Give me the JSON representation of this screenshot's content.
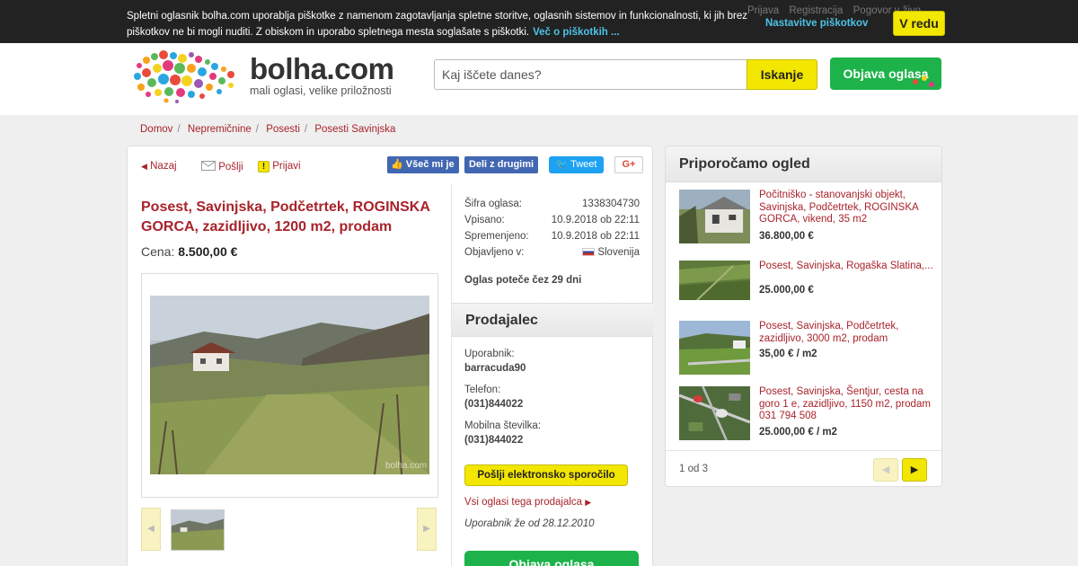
{
  "cookie": {
    "text": "Spletni oglasnik bolha.com uporablja piškotke z namenom zagotavljanja spletne storitve, oglasnih sistemov in funkcionalnosti, ki jih brez piškotkov ne bi mogli nuditi. Z obiskom in uporabo spletnega mesta soglašate s piškotki.",
    "more_link": "Več o piškotkih ...",
    "settings_link": "Nastavitve piškotkov",
    "ok_label": "V redu"
  },
  "top_links": [
    "Prijava",
    "Registracija",
    "Pogovor v živo"
  ],
  "header": {
    "logo_text": "bolha.com",
    "tagline": "mali oglasi, velike priložnosti",
    "search_placeholder": "Kaj iščete danes?",
    "search_label": "Iskanje",
    "post_label": "Objava oglasa"
  },
  "breadcrumb": [
    "Domov",
    "Nepremičnine",
    "Posesti",
    "Posesti Savinjska"
  ],
  "toolbar": {
    "back": "Nazaj",
    "send": "Pošlji",
    "report": "Prijavi",
    "like": "Všeč mi je",
    "share": "Deli z drugimi",
    "tweet": "Tweet",
    "gplus": "G+"
  },
  "ad": {
    "title": "Posest, Savinjska, Podčetrtek, ROGINSKA GORCA, zazidljivo, 1200 m2, prodam",
    "price_label": "Cena:",
    "price_value": "8.500,00 €",
    "watermark": "bolha.com"
  },
  "info": {
    "rows": [
      {
        "k": "Šifra oglasa:",
        "v": "1338304730"
      },
      {
        "k": "Vpisano:",
        "v": "10.9.2018 ob 22:11"
      },
      {
        "k": "Spremenjeno:",
        "v": "10.9.2018 ob 22:11"
      },
      {
        "k": "Objavljeno v:",
        "v": "Slovenija"
      }
    ],
    "expires": "Oglas poteče čez 29 dni"
  },
  "seller": {
    "heading": "Prodajalec",
    "user_label": "Uporabnik:",
    "user_value": "barracuda90",
    "phone_label": "Telefon:",
    "phone_value": "(031)844022",
    "mobile_label": "Mobilna številka:",
    "mobile_value": "(031)844022",
    "message_button": "Pošlji elektronsko sporočilo",
    "all_ads": "Vsi oglasi tega prodajalca",
    "since": "Uporabnik že od 28.12.2010",
    "bottom_button": "Objava oglasa"
  },
  "recommended": {
    "heading": "Priporočamo ogled",
    "items": [
      {
        "title": "Počitniško - stanovanjski objekt, Savinjska, Podčetrtek, ROGINSKA GORCA, vikend, 35 m2",
        "price": "36.800,00 €"
      },
      {
        "title": "Posest, Savinjska, Rogaška Slatina,...",
        "price": "25.000,00 €"
      },
      {
        "title": "Posest, Savinjska, Podčetrtek, zazidljivo, 3000 m2, prodam",
        "price": "35,00 € / m2"
      },
      {
        "title": "Posest, Savinjska, Šentjur, cesta na goro 1 e, zazidljivo, 1150 m2, prodam 031 794 508",
        "price": "25.000,00 € / m2"
      }
    ],
    "pager": "1 od 3"
  },
  "colors": {
    "brand_red": "#a8232b",
    "yellow": "#f3e600",
    "green": "#1db34a",
    "facebook": "#4267b2",
    "twitter": "#1da1f2"
  }
}
